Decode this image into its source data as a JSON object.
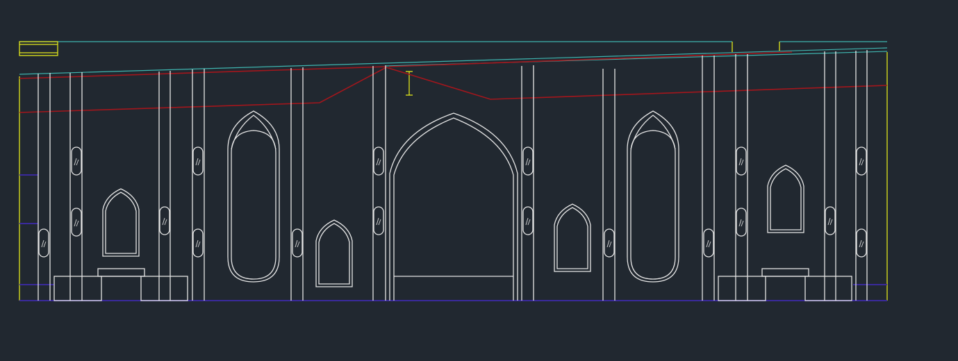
{
  "drawing": {
    "background_color": "#212830",
    "line_colors": {
      "outline": "#e6e6e6",
      "roof": "#3fb6b0",
      "section": "#a4161c",
      "boundary": "#e2e61c",
      "floor": "#3a2a9c"
    },
    "elements": [
      "columns",
      "arched-niches",
      "central-arch",
      "mirror-panels",
      "counter-blocks"
    ]
  }
}
